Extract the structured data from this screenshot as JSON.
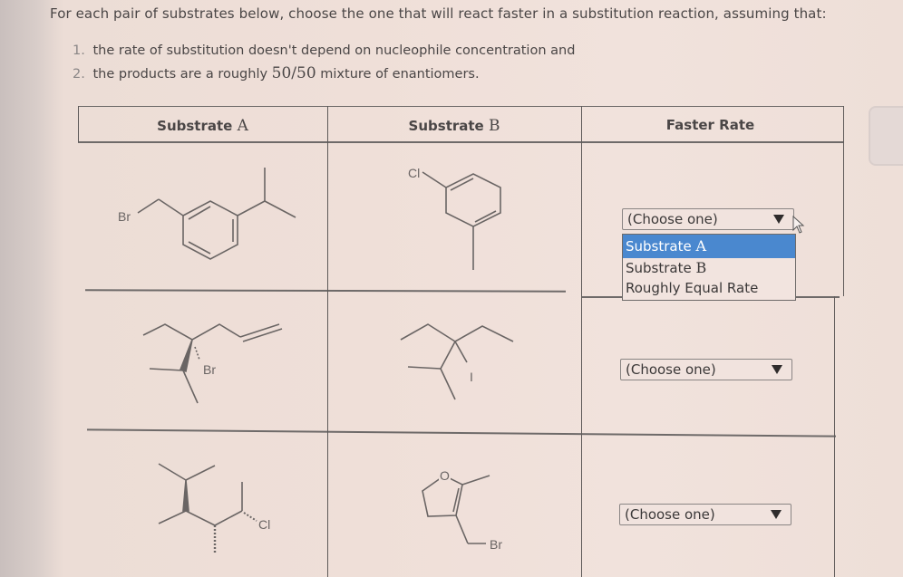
{
  "prompt": "For each pair of substrates below, choose the one that will react faster in a substitution reaction, assuming that:",
  "conditions": [
    {
      "num": "1.",
      "text": "the rate of substitution doesn't depend on nucleophile concentration and"
    },
    {
      "num": "2.",
      "pre": "the products are a roughly ",
      "ratio": "50/50",
      "post": " mixture of enantiomers."
    }
  ],
  "table": {
    "headers": {
      "a_prefix": "Substrate ",
      "a_letter": "A",
      "b_prefix": "Substrate ",
      "b_letter": "B",
      "rate": "Faster Rate"
    },
    "rows": [
      {
        "substrate_a": {
          "name": "1-(bromomethyl)-3-isopropylbenzene",
          "label": "Br"
        },
        "substrate_b": {
          "name": "1-chloro-5-methylcyclohexa-1,4-diene",
          "label": "Cl"
        },
        "select": {
          "value": "(Choose one)",
          "open": true
        }
      },
      {
        "substrate_a": {
          "name": "tertiary allylic-chain bromide (wedge/dash)",
          "label": "Br"
        },
        "substrate_b": {
          "name": "tertiary alkyl iodide",
          "label": "I"
        },
        "select": {
          "value": "(Choose one)",
          "open": false
        }
      },
      {
        "substrate_a": {
          "name": "secondary alkyl chloride (stereocenters)",
          "label": "Cl"
        },
        "substrate_b": {
          "name": "3-(bromomethyl)-2-methyl-4,5-dihydrofuran",
          "label_o": "O",
          "label": "Br"
        },
        "select": {
          "value": "(Choose one)",
          "open": false
        }
      }
    ]
  },
  "dropdown_menu": {
    "options": [
      {
        "prefix": "Substrate ",
        "letter": "A",
        "highlighted": true
      },
      {
        "prefix": "Substrate ",
        "letter": "B",
        "highlighted": false
      },
      {
        "prefix": "Roughly Equal Rate",
        "letter": "",
        "highlighted": false
      }
    ]
  },
  "colors": {
    "highlight": "#4a88cf",
    "border": "#6e6a69"
  }
}
